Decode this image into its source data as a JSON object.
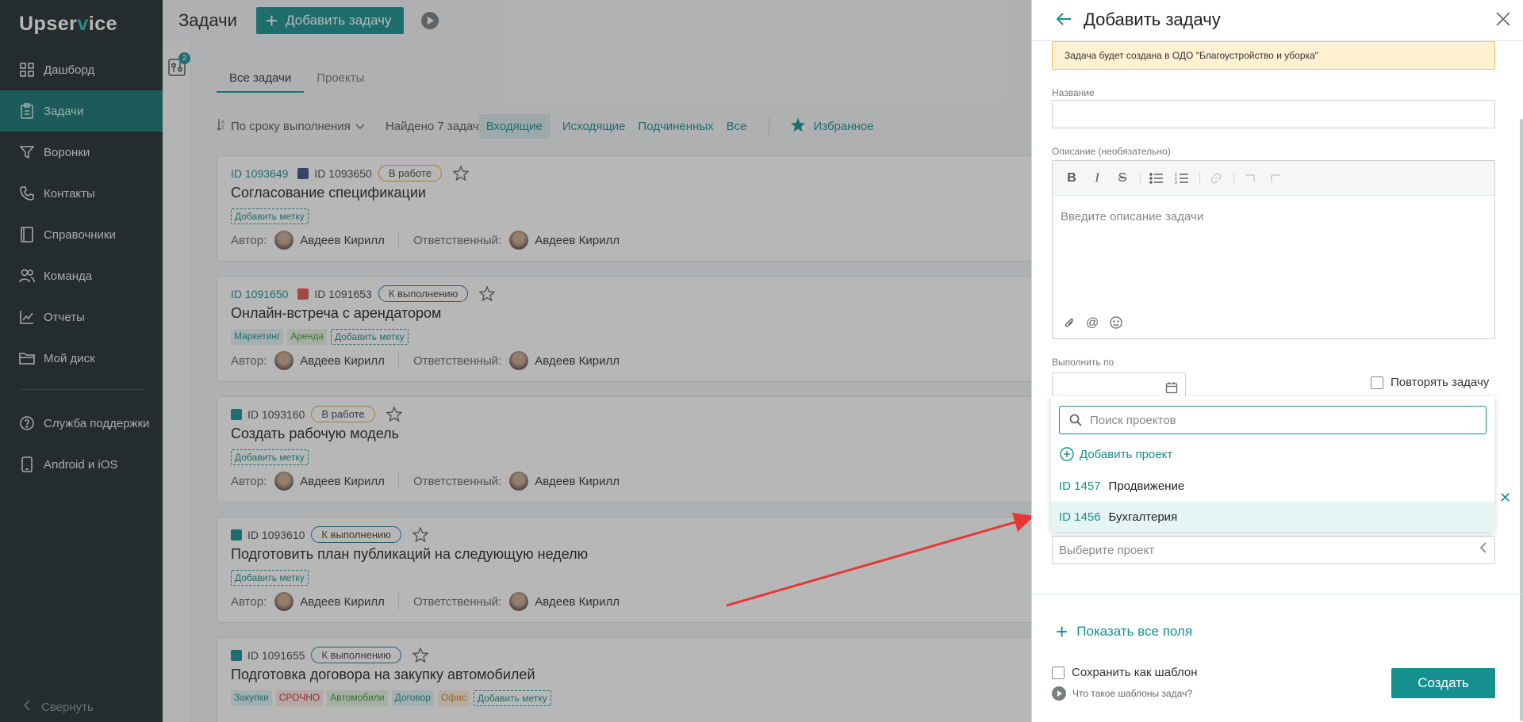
{
  "sidebar": {
    "logo_pre": "Upser",
    "logo_v": "v",
    "logo_post": "ice",
    "items": [
      {
        "label": "Дашборд",
        "icon": "grid-icon"
      },
      {
        "label": "Задачи",
        "icon": "clipboard-icon",
        "active": true
      },
      {
        "label": "Воронки",
        "icon": "funnel-icon"
      },
      {
        "label": "Контакты",
        "icon": "phone-icon"
      },
      {
        "label": "Справочники",
        "icon": "book-icon"
      },
      {
        "label": "Команда",
        "icon": "team-icon"
      },
      {
        "label": "Отчеты",
        "icon": "chart-icon"
      },
      {
        "label": "Мой диск",
        "icon": "folder-icon"
      }
    ],
    "support": "Служба поддержки",
    "mobile": "Android и iOS",
    "collapse": "Свернуть"
  },
  "header": {
    "title": "Задачи",
    "add_button": "Добавить задачу",
    "filter_badge": "2"
  },
  "tabs": [
    {
      "label": "Все задачи",
      "active": true
    },
    {
      "label": "Проекты",
      "active": false
    }
  ],
  "toolbar": {
    "sort": "По сроку выполнения",
    "found": "Найдено 7 задач",
    "filters": [
      "Входящие",
      "Исходящие",
      "Подчиненных",
      "Все"
    ],
    "active_filter": "Входящие",
    "favorites": "Избранное"
  },
  "labels": {
    "author": "Автор:",
    "responsible": "Ответственный:",
    "add_tag": "Добавить метку"
  },
  "tasks": [
    {
      "id": "ID 1093649",
      "sub_id": "ID 1093650",
      "status": "В работе",
      "title": "Согласование спецификации",
      "tags": [],
      "author": "Авдеев Кирилл",
      "responsible": "Авдеев Кирилл"
    },
    {
      "id": "ID 1091650",
      "sub_id": "ID 1091653",
      "status": "К выполнению",
      "title": "Онлайн-встреча с арендатором",
      "tags": [
        "Маркетинг",
        "Аренда"
      ],
      "author": "Авдеев Кирилл",
      "responsible": "Авдеев Кирилл"
    },
    {
      "id": "",
      "sub_id": "ID 1093160",
      "status": "В работе",
      "title": "Создать рабочую модель",
      "tags": [],
      "author": "Авдеев Кирилл",
      "responsible": "Авдеев Кирилл"
    },
    {
      "id": "",
      "sub_id": "ID 1093610",
      "status": "К выполнению",
      "title": "Подготовить план публикаций на следующую неделю",
      "tags": [],
      "author": "Авдеев Кирилл",
      "responsible": "Авдеев Кирилл"
    },
    {
      "id": "",
      "sub_id": "ID 1091655",
      "status": "К выполнению",
      "title": "Подготовка договора на закупку автомобилей",
      "tags": [
        "Закупки",
        "СРОЧНО",
        "Автомобили",
        "Договор",
        "Офис"
      ],
      "author": "",
      "responsible": ""
    }
  ],
  "panel": {
    "title": "Добавить задачу",
    "notice": "Задача будет создана в ОДО \"Благоустройство и уборка\"",
    "name_label": "Название",
    "name_value": "",
    "desc_label": "Описание (необязательно)",
    "desc_placeholder": "Введите описание задачи",
    "due_label": "Выполнить по",
    "repeat": "Повторять задачу",
    "project_search_placeholder": "Поиск проектов",
    "add_project": "Добавить проект",
    "projects": [
      {
        "id": "ID 1457",
        "name": "Продвижение"
      },
      {
        "id": "ID 1456",
        "name": "Бухгалтерия",
        "highlighted": true
      }
    ],
    "project_placeholder": "Выберите проект",
    "show_all": "Показать все поля",
    "save_template": "Сохранить как шаблон",
    "template_help": "Что такое шаблоны задач?",
    "create": "Создать"
  },
  "colors": {
    "accent": "#168f8f",
    "sidebar_bg": "#1e2a2c",
    "sidebar_active": "#137070",
    "notice_bg": "#fff1d2",
    "arrow": "#e53935",
    "status_in_work": "#e8a23a",
    "status_todo": "#1a79a6"
  }
}
